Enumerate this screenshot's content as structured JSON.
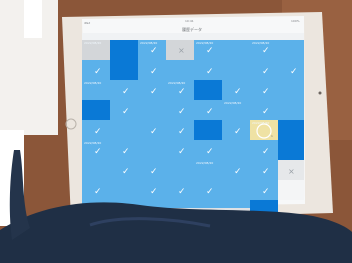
{
  "screen": {
    "title": "履歴データ",
    "status_time": "10:41",
    "status_left": "iPad",
    "status_right": "100%"
  },
  "grid": {
    "cell_label": "2022/08/20",
    "check_glyph": "✓",
    "cross_glyph": "×",
    "highlight_value": "1"
  },
  "colors": {
    "cell_light": "#5bb1ea",
    "cell_dark": "#0a79d6",
    "cell_gray": "#d3d6d9",
    "cell_highlight": "#efe2a4",
    "table": "#8f5a3b",
    "device_frame": "#ece6df",
    "clothing": "#1f2f45"
  }
}
